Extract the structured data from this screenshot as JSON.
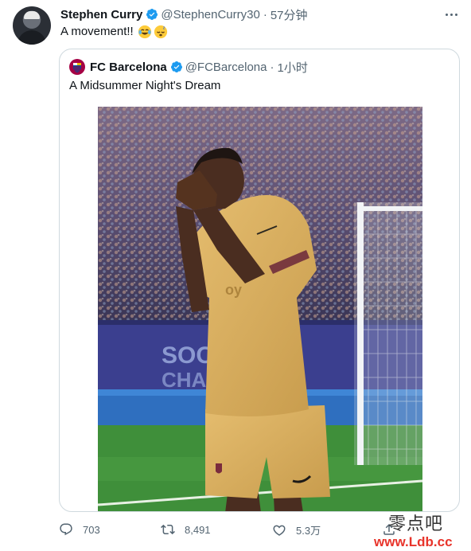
{
  "tweet": {
    "author_name": "Stephen Curry",
    "author_handle": "@StephenCurry30",
    "separator": "·",
    "time": "57分钟",
    "text": "A movement!!",
    "emojis": [
      "face-with-tears-of-joy",
      "sleeping-face"
    ],
    "avatar": "stephen-curry-avatar"
  },
  "quoted_tweet": {
    "author_name": "FC Barcelona",
    "author_handle": "@FCBarcelona",
    "separator": "·",
    "time": "1小时",
    "text": "A Midsummer Night's Dream",
    "logo": "fc-barcelona-crest",
    "image": "player-sleeping-celebration-photo"
  },
  "actions": {
    "reply_count": "703",
    "retweet_count": "8,491",
    "like_count": "5.3万"
  },
  "watermark": {
    "line1": "零点吧",
    "line2": "www.Ldb.cc"
  },
  "colors": {
    "verified": "#1d9bf0",
    "muted_text": "#536471",
    "border": "#cfd9de",
    "kit_gold": "#d9ad5c"
  }
}
